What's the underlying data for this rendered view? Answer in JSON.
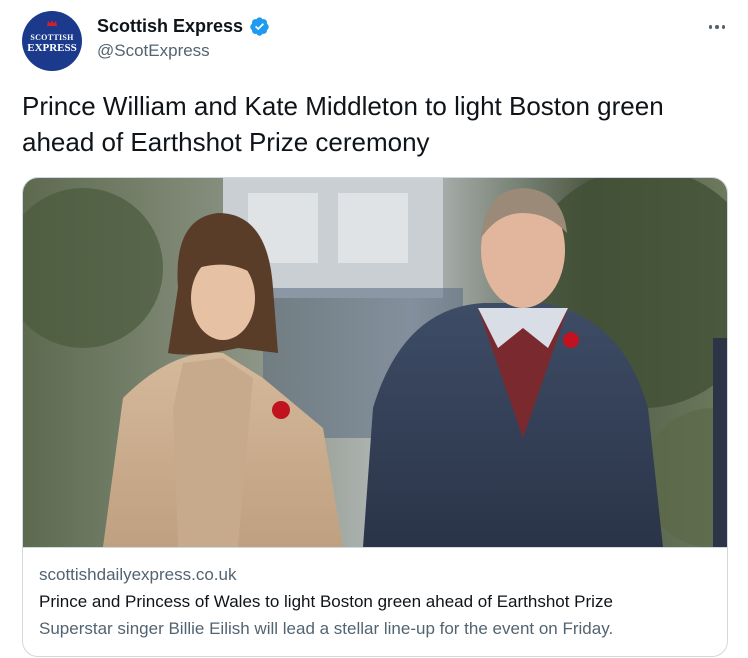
{
  "author": {
    "name": "Scottish Express",
    "handle": "@ScotExpress",
    "avatar_text_top": "SCOTTISH",
    "avatar_text_bottom": "EXPRESS",
    "verified": true
  },
  "tweet": {
    "text": "Prince William and Kate Middleton to light Boston green ahead of Earthshot Prize ceremony"
  },
  "card": {
    "domain": "scottishdailyexpress.co.uk",
    "title": "Prince and Princess of Wales to light Boston green ahead of Earthshot Prize",
    "description": "Superstar singer Billie Eilish will lead a stellar line-up for the event on Friday."
  },
  "icons": {
    "verified": "verified-badge-icon",
    "more": "more-options-icon"
  },
  "colors": {
    "verified_blue": "#1d9bf0",
    "avatar_blue": "#1b3a8c",
    "secondary_text": "#536471",
    "primary_text": "#0f1419",
    "card_border": "#cfd9de"
  }
}
